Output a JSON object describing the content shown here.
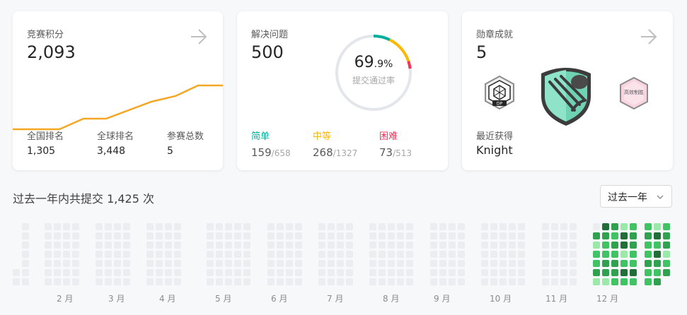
{
  "contest": {
    "label": "竞赛积分",
    "rating": "2,093",
    "stats": [
      {
        "label": "全国排名",
        "value": "1,305"
      },
      {
        "label": "全球排名",
        "value": "3,448"
      },
      {
        "label": "参赛总数",
        "value": "5"
      }
    ]
  },
  "solved": {
    "label": "解决问题",
    "count": "500",
    "rate_main": "69",
    "rate_decimal": ".9%",
    "rate_label": "提交通过率",
    "difficulties": [
      {
        "label": "简单",
        "solved": "159",
        "total": "658",
        "color": "#00af9b"
      },
      {
        "label": "中等",
        "solved": "268",
        "total": "1327",
        "color": "#ffb800"
      },
      {
        "label": "困难",
        "solved": "73",
        "total": "513",
        "color": "#ff2d55"
      }
    ]
  },
  "badges": {
    "label": "勋章成就",
    "count": "5",
    "recent_label": "最近获得",
    "recent_value": "Knight",
    "small_badge_text": "DP",
    "right_badge_text": "高效制胜"
  },
  "heatmap": {
    "title": "过去一年内共提交 1,425 次",
    "select_value": "过去一年",
    "months": [
      "2 月",
      "3 月",
      "4 月",
      "5 月",
      "6 月",
      "7 月",
      "8 月",
      "9 月",
      "10 月",
      "11 月",
      "12 月"
    ]
  },
  "colors": {
    "accent_orange": "#f5a623",
    "easy": "#00af9b",
    "medium": "#ffb800",
    "hard": "#ff2d55",
    "heat_empty": "#ebedf0"
  }
}
